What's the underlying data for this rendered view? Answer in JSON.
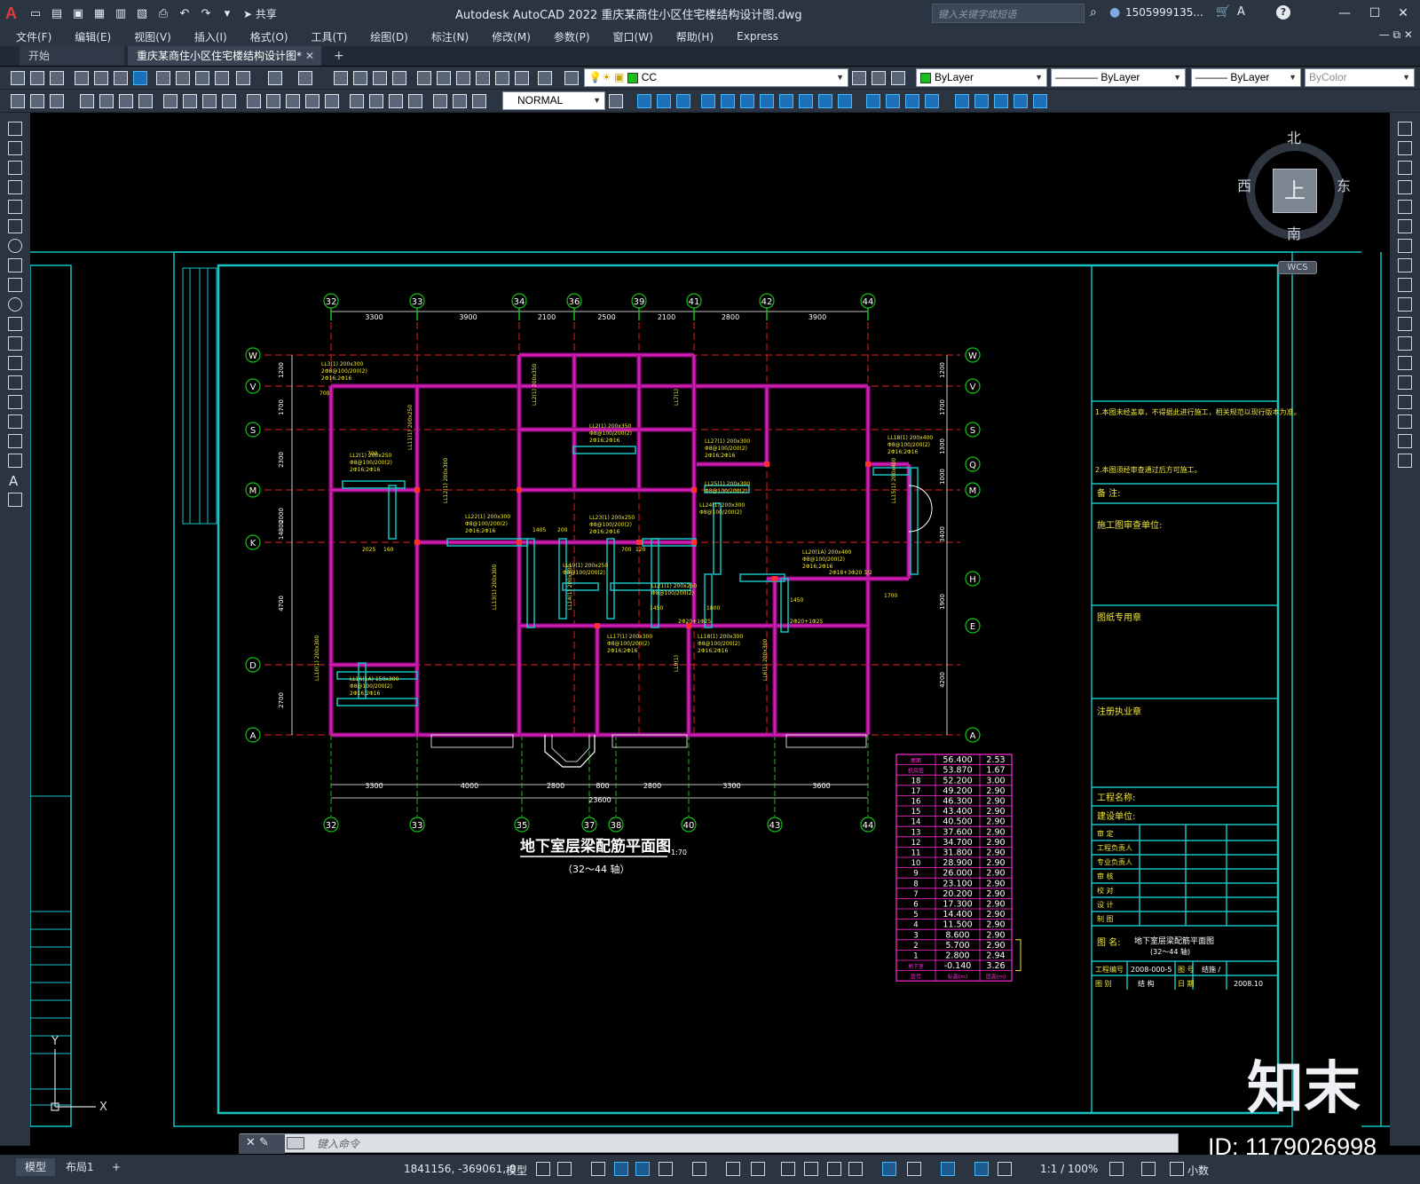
{
  "app": {
    "logo": "A",
    "title": "Autodesk AutoCAD 2022    重庆某商住小区住宅楼结构设计图.dwg",
    "share_label": "共享",
    "search_placeholder": "键入关键字或短语",
    "user_name": "1505999135...",
    "help": "?"
  },
  "menu": [
    "文件(F)",
    "编辑(E)",
    "视图(V)",
    "插入(I)",
    "格式(O)",
    "工具(T)",
    "绘图(D)",
    "标注(N)",
    "修改(M)",
    "参数(P)",
    "窗口(W)",
    "帮助(H)",
    "Express"
  ],
  "tabs": {
    "start": "开始",
    "drawing": "重庆某商住小区住宅楼结构设计图*",
    "close": "✕",
    "add": "+"
  },
  "toolbar1": {
    "layer": "CC",
    "layer_color": "#18c018",
    "color_select": "ByLayer",
    "color_swatch": "#18c018",
    "linetype": "ByLayer",
    "lineweight": "ByLayer",
    "plotstyle": "ByColor"
  },
  "toolbar2": {
    "dimstyle": "NORMAL"
  },
  "viewcube": {
    "north": "北",
    "south": "南",
    "east": "东",
    "west": "西",
    "top": "上",
    "wcs": "WCS"
  },
  "drawing": {
    "title": "地下室层梁配筋平面图",
    "scale": "1:70",
    "subtitle": "（32～44 轴）",
    "top_axes": [
      "32",
      "33",
      "34",
      "36",
      "39",
      "41",
      "42",
      "44"
    ],
    "top_dims": [
      "3300",
      "3900",
      "2100",
      "2500",
      "2100",
      "2800",
      "3900"
    ],
    "bottom_axes": [
      "32",
      "33",
      "35",
      "37",
      "38",
      "40",
      "43",
      "44"
    ],
    "bottom_dims": [
      "3300",
      "4000",
      "2800",
      "800",
      "2800",
      "3300",
      "3600"
    ],
    "total_dim": "23600",
    "left_axes": [
      "W",
      "V",
      "S",
      "M",
      "K",
      "D",
      "A"
    ],
    "right_axes": [
      "W",
      "V",
      "S",
      "Q",
      "M",
      "H",
      "E",
      "A"
    ],
    "left_dims": [
      "1200",
      "1700",
      "2300",
      "2000",
      "14800",
      "4700",
      "2700"
    ],
    "right_dims": [
      "1200",
      "1700",
      "1300",
      "1000",
      "3400",
      "1900",
      "4200"
    ]
  },
  "level_table": {
    "rows": [
      [
        "屋面",
        "56.400",
        "2.53"
      ],
      [
        "机房层",
        "53.870",
        "1.67"
      ],
      [
        "18",
        "52.200",
        "3.00"
      ],
      [
        "17",
        "49.200",
        "2.90"
      ],
      [
        "16",
        "46.300",
        "2.90"
      ],
      [
        "15",
        "43.400",
        "2.90"
      ],
      [
        "14",
        "40.500",
        "2.90"
      ],
      [
        "13",
        "37.600",
        "2.90"
      ],
      [
        "12",
        "34.700",
        "2.90"
      ],
      [
        "11",
        "31.800",
        "2.90"
      ],
      [
        "10",
        "28.900",
        "2.90"
      ],
      [
        "9",
        "26.000",
        "2.90"
      ],
      [
        "8",
        "23.100",
        "2.90"
      ],
      [
        "7",
        "20.200",
        "2.90"
      ],
      [
        "6",
        "17.300",
        "2.90"
      ],
      [
        "5",
        "14.400",
        "2.90"
      ],
      [
        "4",
        "11.500",
        "2.90"
      ],
      [
        "3",
        "8.600",
        "2.90"
      ],
      [
        "2",
        "5.700",
        "2.90"
      ],
      [
        "1",
        "2.800",
        "2.94"
      ],
      [
        "地下室",
        "-0.140",
        "3.26"
      ]
    ],
    "footer": [
      "层号",
      "标高(m)",
      "层高(m)"
    ]
  },
  "title_block": {
    "note1": "1.本图未经盖章，不得据此进行施工，相关规范以现行版本为准。",
    "note2": "2.本图须经审查通过后方可施工。",
    "remarks": "备 注:",
    "review_unit": "施工图审查单位:",
    "stamp": "图纸专用章",
    "reg_stamp": "注册执业章",
    "project": "工程名称:",
    "client": "建设单位:",
    "roles": [
      "审 定",
      "工程负责人",
      "专业负责人",
      "审 核",
      "校 对",
      "设 计",
      "制 图"
    ],
    "drawing_name_label": "图 名:",
    "drawing_name": "地下室层梁配筋平面图",
    "drawing_axes": "(32～44 轴)",
    "project_no_label": "工程编号",
    "project_no": "2008-000-5",
    "sheet_no_label": "图 号",
    "sheet_no": "结施 /",
    "category_label": "图 别",
    "category": "结 构",
    "date_label": "日 期",
    "date": "2008.10"
  },
  "watermark": {
    "logo": "知末",
    "id": "ID: 1179026998"
  },
  "cmdline": {
    "placeholder": "键入命令"
  },
  "status": {
    "layout_tabs": [
      "模型",
      "布局1",
      "+"
    ],
    "coords": "1841156, -369061, 0",
    "space": "模型",
    "scale": "1:1 / 100%",
    "units": "小数"
  }
}
